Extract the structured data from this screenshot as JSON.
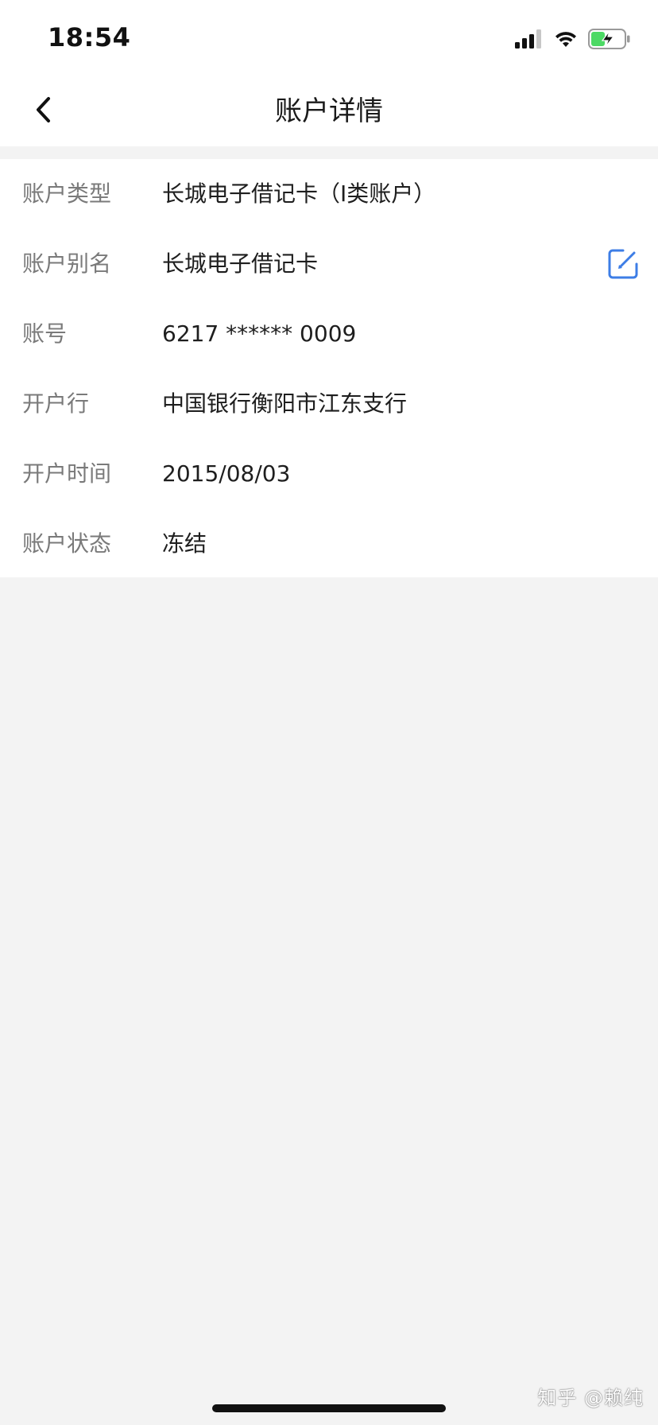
{
  "status_bar": {
    "time": "18:54",
    "icons": [
      "signal-icon",
      "wifi-icon",
      "battery-charging-icon"
    ]
  },
  "nav": {
    "title": "账户详情",
    "back_icon": "chevron-left-icon"
  },
  "details": [
    {
      "label": "账户类型",
      "value": "长城电子借记卡（I类账户）"
    },
    {
      "label": "账户别名",
      "value": "长城电子借记卡",
      "action_icon": "edit-icon"
    },
    {
      "label": "账号",
      "value": "6217 ****** 0009"
    },
    {
      "label": "开户行",
      "value": "中国银行衡阳市江东支行"
    },
    {
      "label": "开户时间",
      "value": "2015/08/03"
    },
    {
      "label": "账户状态",
      "value": "冻结"
    }
  ],
  "watermark": "知乎 @赖纯",
  "colors": {
    "accent": "#3d7de6",
    "battery_green": "#4cd964",
    "background": "#f3f3f3",
    "card": "#ffffff"
  }
}
